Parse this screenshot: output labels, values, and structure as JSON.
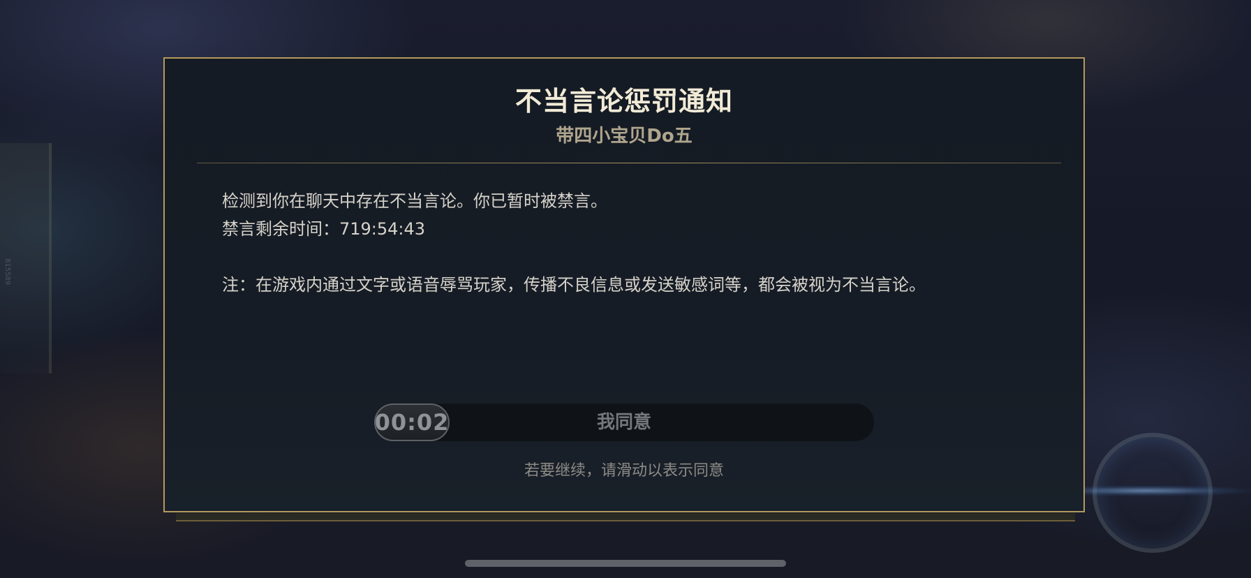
{
  "dialog": {
    "title": "不当言论惩罚通知",
    "subtitle": "带四小宝贝Do五",
    "message": "检测到你在聊天中存在不当言论。你已暂时被禁言。",
    "mute_remaining": "禁言剩余时间：719:54:43",
    "note": "注：在游戏内通过文字或语音辱骂玩家，传播不良信息或发送敏感词等，都会被视为不当言论。",
    "slider": {
      "countdown": "00:02",
      "label": "我同意"
    },
    "hint": "若要继续，请滑动以表示同意"
  },
  "background": {
    "side_tag": "815589"
  },
  "colors": {
    "border_gold": "#b49a5e",
    "title": "#f1ead6",
    "dialog_bg": "#151b24"
  }
}
